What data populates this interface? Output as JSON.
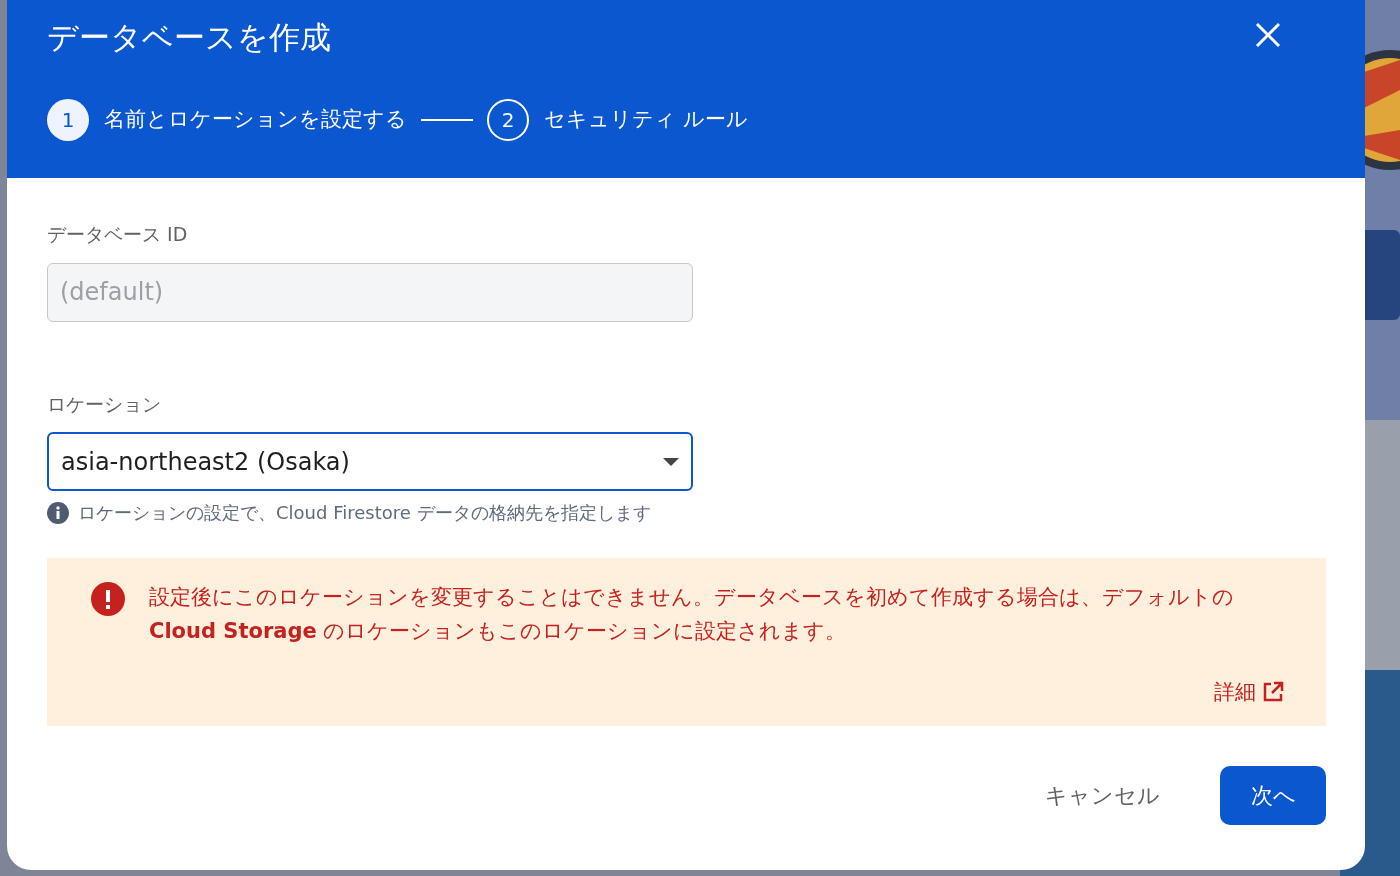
{
  "dialog": {
    "title": "データベースを作成",
    "steps": [
      {
        "number": "1",
        "label": "名前とロケーションを設定する",
        "selected": true
      },
      {
        "number": "2",
        "label": "セキュリティ ルール",
        "selected": false
      }
    ],
    "fields": [
      {
        "kind": "text",
        "label": "データベース ID",
        "value": "(default)",
        "disabled": true
      },
      {
        "kind": "select",
        "label": "ロケーション",
        "value": "asia-northeast2 (Osaka)",
        "disabled": false,
        "hint": "ロケーションの設定で、Cloud Firestore データの格納先を指定します"
      }
    ],
    "warning": {
      "text": "設定後にこのロケーションを変更することはできません。データベースを初めて作成する場合は、デフォルトの **Cloud Storage** のロケーションもこのロケーションに設定されます。",
      "link": "詳細"
    },
    "buttons": [
      {
        "kind": "text",
        "label": "キャンセル"
      },
      {
        "kind": "primary",
        "label": "次へ"
      }
    ]
  }
}
